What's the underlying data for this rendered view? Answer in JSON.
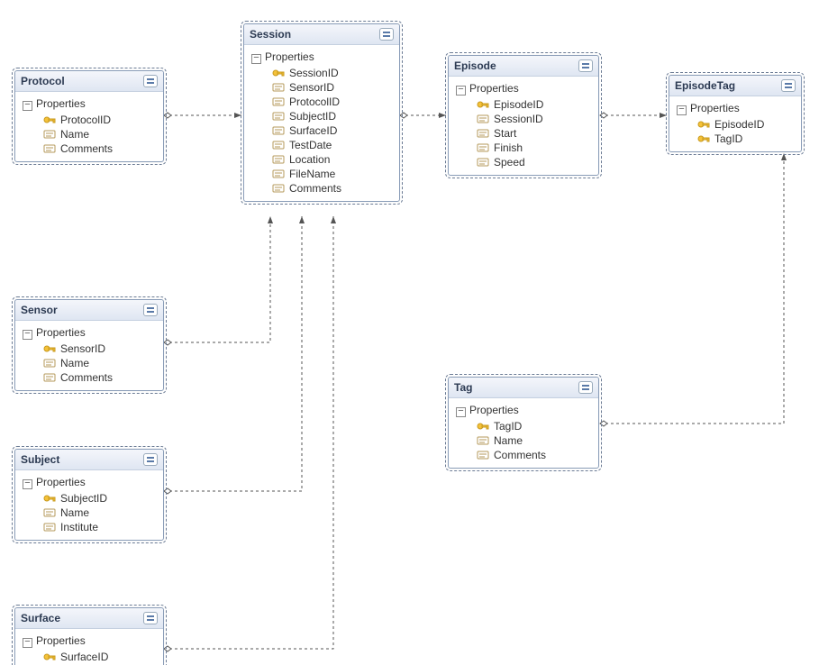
{
  "properties_label": "Properties",
  "entities": {
    "protocol": {
      "title": "Protocol",
      "props": [
        {
          "key": true,
          "name": "ProtocolID"
        },
        {
          "key": false,
          "name": "Name"
        },
        {
          "key": false,
          "name": "Comments"
        }
      ]
    },
    "session": {
      "title": "Session",
      "props": [
        {
          "key": true,
          "name": "SessionID"
        },
        {
          "key": false,
          "name": "SensorID"
        },
        {
          "key": false,
          "name": "ProtocolID"
        },
        {
          "key": false,
          "name": "SubjectID"
        },
        {
          "key": false,
          "name": "SurfaceID"
        },
        {
          "key": false,
          "name": "TestDate"
        },
        {
          "key": false,
          "name": "Location"
        },
        {
          "key": false,
          "name": "FileName"
        },
        {
          "key": false,
          "name": "Comments"
        }
      ]
    },
    "episode": {
      "title": "Episode",
      "props": [
        {
          "key": true,
          "name": "EpisodeID"
        },
        {
          "key": false,
          "name": "SessionID"
        },
        {
          "key": false,
          "name": "Start"
        },
        {
          "key": false,
          "name": "Finish"
        },
        {
          "key": false,
          "name": "Speed"
        }
      ]
    },
    "episodetag": {
      "title": "EpisodeTag",
      "props": [
        {
          "key": true,
          "name": "EpisodeID"
        },
        {
          "key": true,
          "name": "TagID"
        }
      ]
    },
    "sensor": {
      "title": "Sensor",
      "props": [
        {
          "key": true,
          "name": "SensorID"
        },
        {
          "key": false,
          "name": "Name"
        },
        {
          "key": false,
          "name": "Comments"
        }
      ]
    },
    "subject": {
      "title": "Subject",
      "props": [
        {
          "key": true,
          "name": "SubjectID"
        },
        {
          "key": false,
          "name": "Name"
        },
        {
          "key": false,
          "name": "Institute"
        }
      ]
    },
    "tag": {
      "title": "Tag",
      "props": [
        {
          "key": true,
          "name": "TagID"
        },
        {
          "key": false,
          "name": "Name"
        },
        {
          "key": false,
          "name": "Comments"
        }
      ]
    },
    "surface": {
      "title": "Surface",
      "props": [
        {
          "key": true,
          "name": "SurfaceID"
        }
      ]
    }
  }
}
